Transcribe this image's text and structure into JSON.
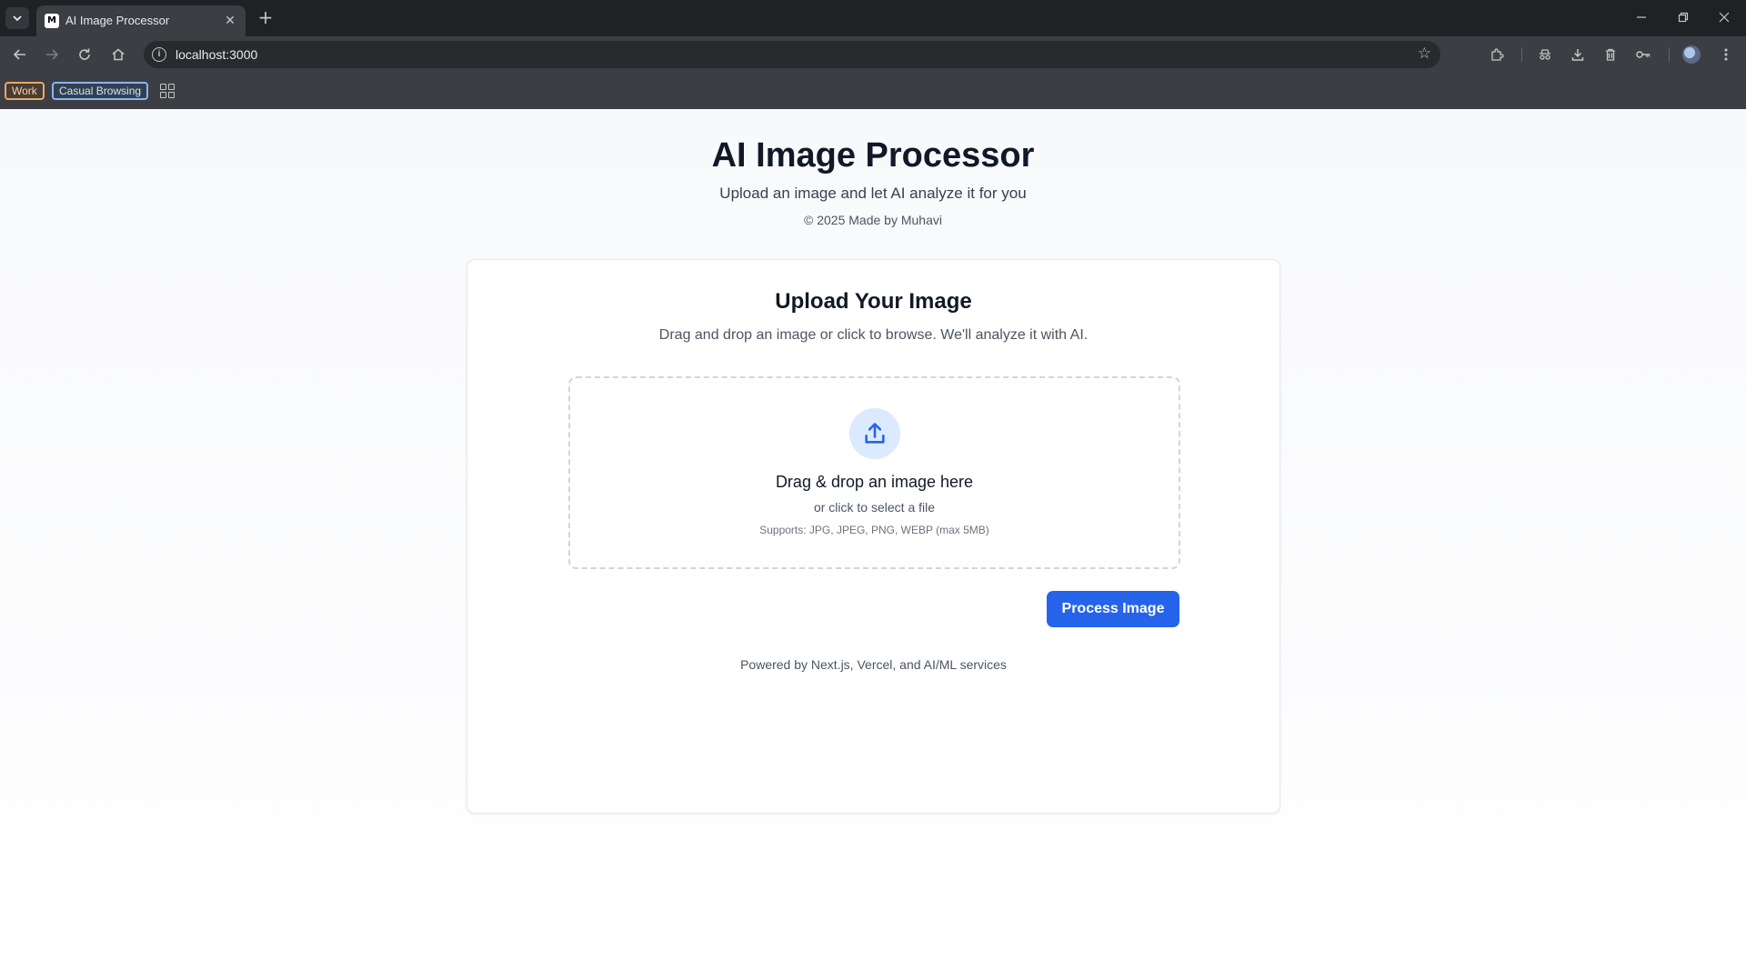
{
  "browser": {
    "tab_title": "AI Image Processor",
    "favicon_text": "M",
    "close_glyph": "✕",
    "new_tab_glyph": "+",
    "url": "localhost:3000",
    "bookmarks": [
      {
        "label": "Work",
        "color": "#e8a86a"
      },
      {
        "label": "Casual Browsing",
        "color": "#8ab4f8"
      }
    ]
  },
  "header": {
    "title": "AI Image Processor",
    "subtitle": "Upload an image and let AI analyze it for you",
    "copyright": "© 2025 Made by Muhavi"
  },
  "card": {
    "title": "Upload Your Image",
    "description": "Drag and drop an image or click to browse. We'll analyze it with AI.",
    "dropzone": {
      "icon": "upload-icon",
      "title": "Drag & drop an image here",
      "subtitle": "or click to select a file",
      "supports": "Supports: JPG, JPEG, PNG, WEBP (max 5MB)"
    },
    "process_button": "Process Image",
    "footer": "Powered by Next.js, Vercel, and AI/ML services"
  },
  "colors": {
    "accent": "#2563eb",
    "icon_bg": "#dbeafe",
    "heading": "#111827"
  }
}
